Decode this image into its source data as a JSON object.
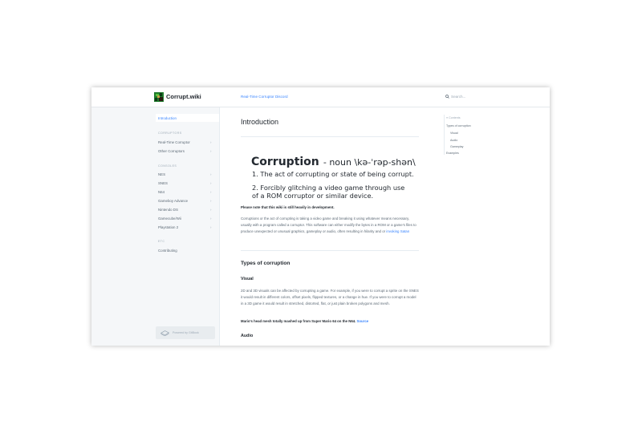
{
  "header": {
    "brand": "Corrupt.wiki",
    "discord_link": "Real-Time Corruptor Discord",
    "search_placeholder": "Search..."
  },
  "sidebar": {
    "top_item": "Introduction",
    "sections": [
      {
        "heading": "CORRUPTORS",
        "items": [
          "Real-Time Corruptor",
          "Other Corruptors"
        ]
      },
      {
        "heading": "CONSOLES",
        "items": [
          "NES",
          "SNES",
          "N64",
          "Gameboy Advance",
          "Nintendo DS",
          "Gamecube/Wii",
          "Playstation 2"
        ]
      },
      {
        "heading": "ETC",
        "items": [
          "Contributing"
        ]
      }
    ],
    "powered_by": "Powered by GitBook"
  },
  "page": {
    "title": "Introduction",
    "definition": {
      "word": "Corruption",
      "pos": "- noun \\kə-ˈrəp-shən\\",
      "sense1": "1. The act of corrupting or state of being corrupt.",
      "sense2": "2. Forcibly glitching a video game through use of a ROM corruptor or similar device."
    },
    "note": "Please note that this wiki is still heavily in development.",
    "intro_paragraph": "Corruptions or the act of corrupting is taking a video game and breaking it using whatever means necessary, usually with a program called a corruptor. This software can either modify the bytes in a ROM or a game's files to produce unexpected or unusual graphics, gameplay or audio, often resulting in hilarity and or",
    "intro_link": "invoking Satan",
    "types_heading": "Types of corruption",
    "visual_heading": "Visual",
    "visual_paragraph": "2D and 3D visuals can be affected by corrupting a game. For example, if you were to corrupt a sprite on the SNES it would result in different colors, offset pixels, flipped textures, or a change in hue. If you were to corrupt a model in a 3D game it would result in stretched, distorted, flat, or just plain broken polygons and mesh.",
    "caption": "Mario's head mesh totally mashed up from Super Mario 64 on the N64.",
    "caption_link": "Source",
    "audio_heading": "Audio"
  },
  "toc": {
    "title": "Contents",
    "items": [
      "Types of corruption",
      "Visual",
      "Audio",
      "Gameplay",
      "Examples"
    ]
  },
  "colors": {
    "accent": "#3884ff",
    "sidebar_bg": "#f5f7f9",
    "text": "#242a31"
  }
}
